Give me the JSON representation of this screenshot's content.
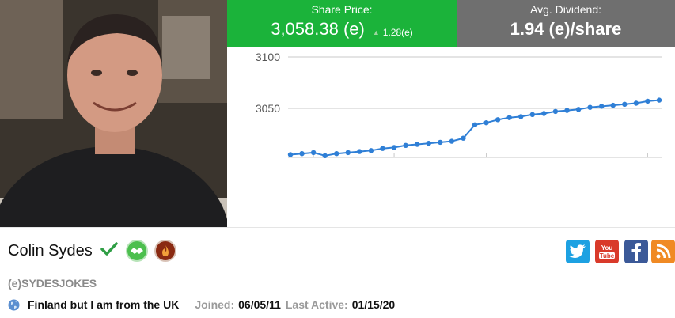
{
  "stats": {
    "price_label": "Share Price:",
    "price_value": "3,058.38 (e)",
    "price_change": "1.28(e)",
    "dividend_label": "Avg. Dividend:",
    "dividend_value": "1.94 (e)/share"
  },
  "colors": {
    "price_box": "#1bb33a",
    "dividend_box": "#6f6f6f",
    "line": "#2f7fd6"
  },
  "chart_data": {
    "type": "line",
    "yticks": [
      "3100",
      "3050"
    ],
    "ylim": [
      3005,
      3100
    ],
    "grid": true,
    "series": [
      {
        "values": [
          3005,
          3006,
          3007,
          3004,
          3006,
          3007,
          3008,
          3009,
          3011,
          3012,
          3014,
          3015,
          3016,
          3017,
          3018,
          3021,
          3034,
          3036,
          3039,
          3041,
          3042,
          3044,
          3045,
          3047,
          3048,
          3049,
          3051,
          3052,
          3053,
          3054,
          3055,
          3057,
          3058
        ]
      }
    ]
  },
  "profile": {
    "name": "Colin Sydes",
    "handle": "(e)SYDESJOKES",
    "location": "Finland but I am from the UK",
    "joined_label": "Joined:",
    "joined_value": "06/05/11",
    "active_label": "Last Active:",
    "active_value": "01/15/20"
  },
  "icons": {
    "verified": "check-icon",
    "badge_1": "handshake-icon",
    "badge_2": "flame-icon",
    "location": "globe-icon",
    "social": [
      "twitter-icon",
      "youtube-icon",
      "facebook-icon",
      "rss-icon"
    ]
  },
  "social": {
    "youtube_line1": "You",
    "youtube_line2": "Tube"
  }
}
